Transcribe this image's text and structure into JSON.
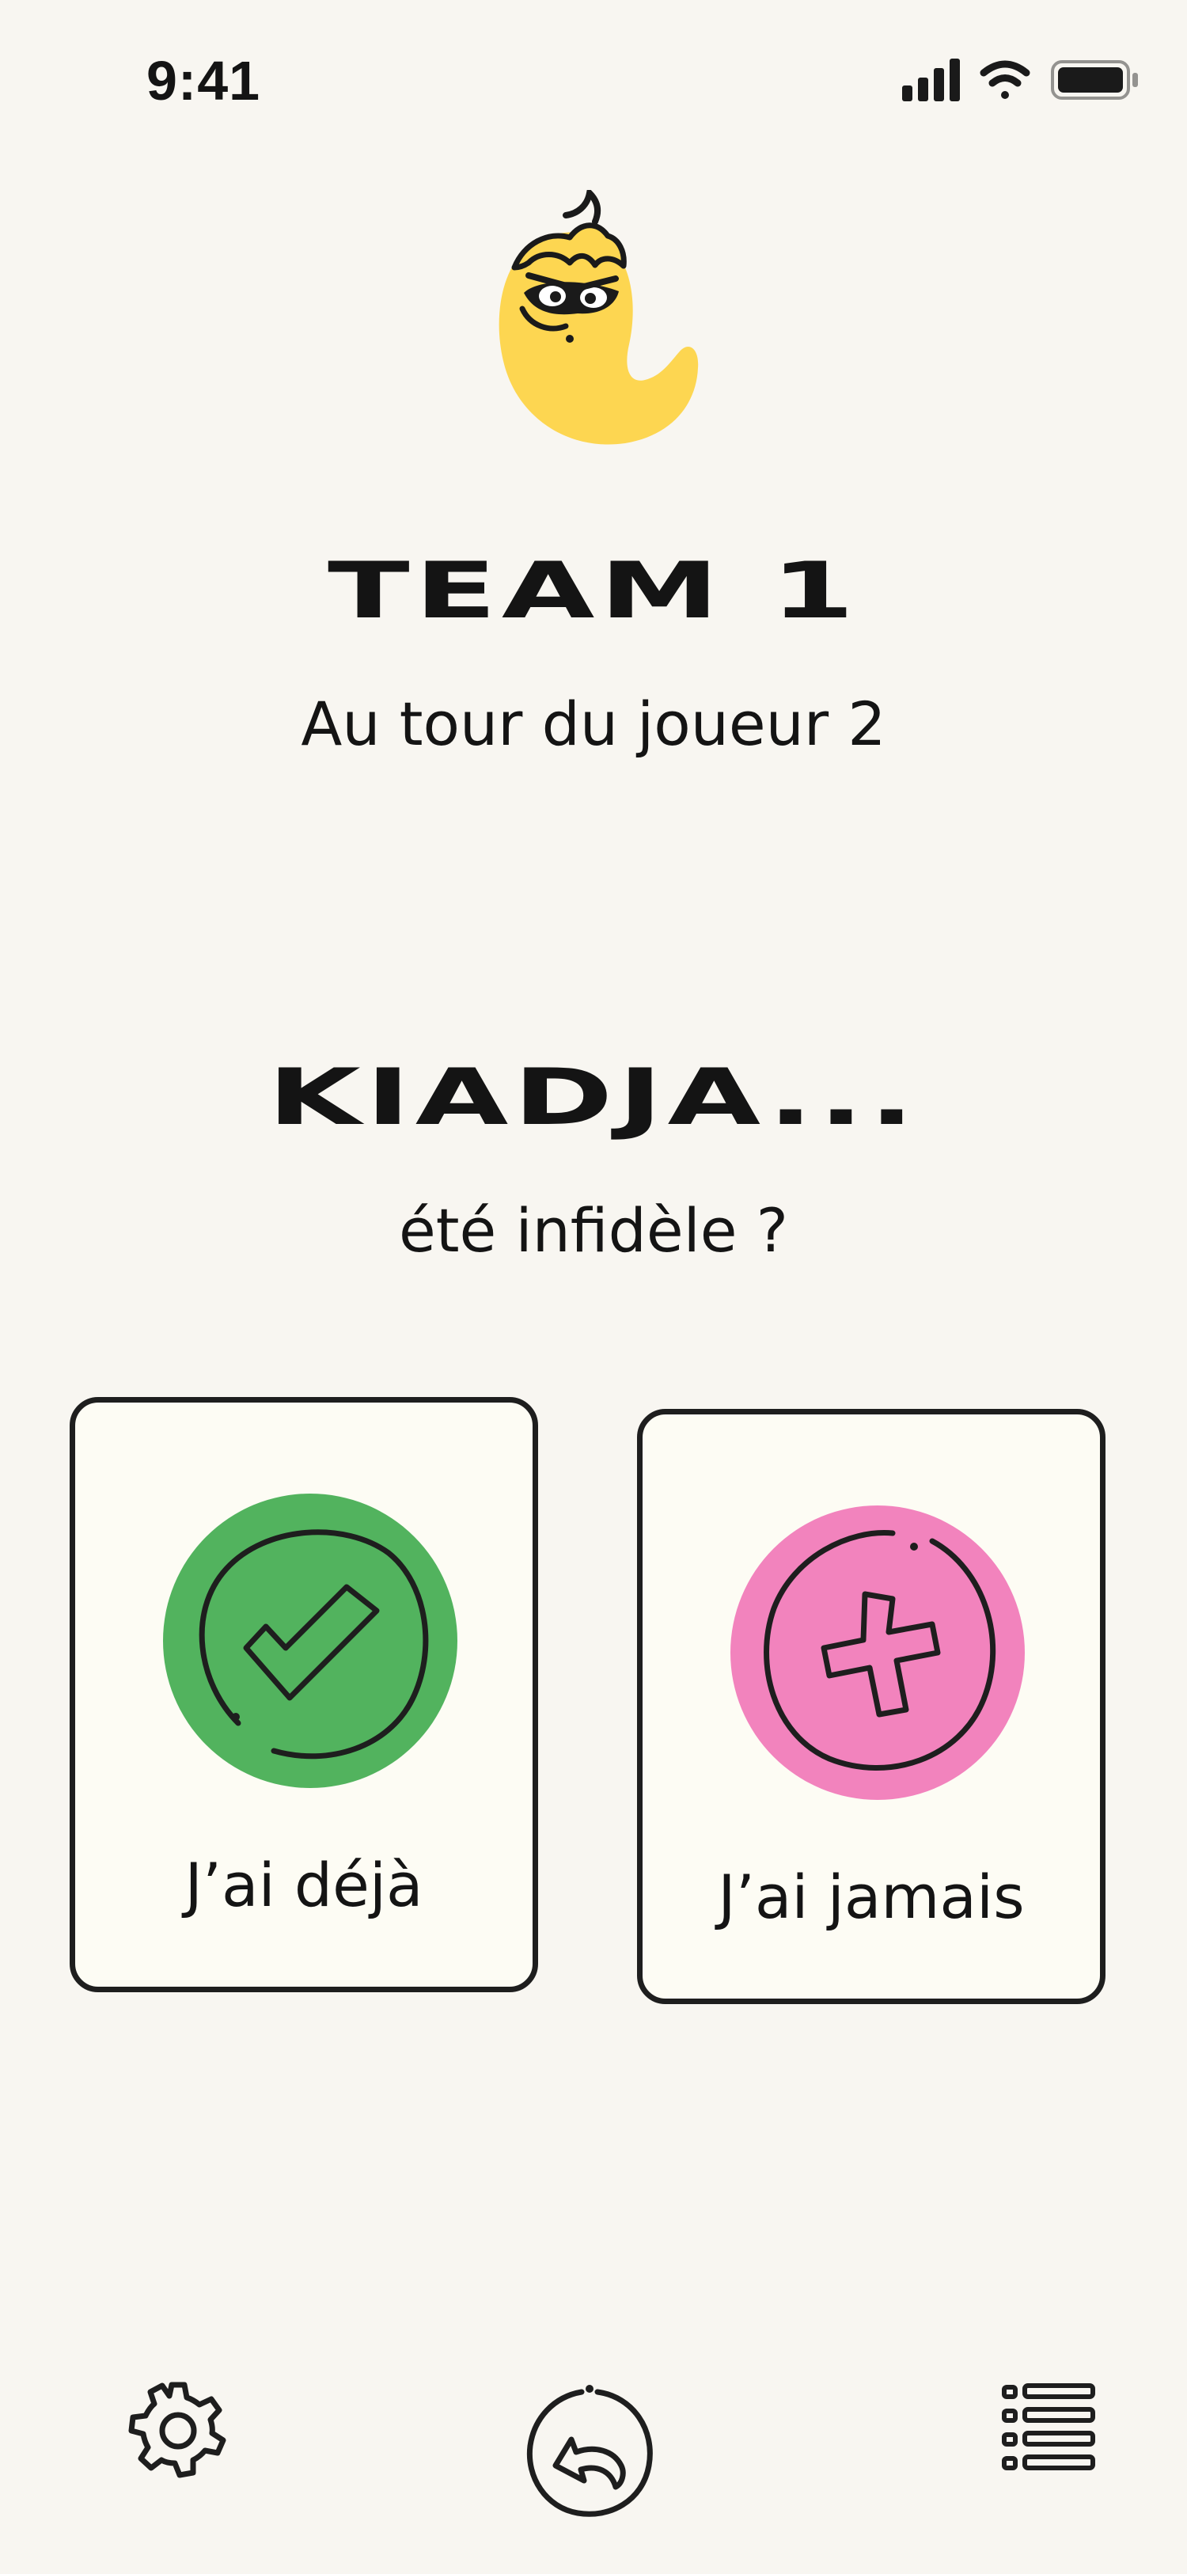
{
  "status_bar": {
    "time": "9:41",
    "icons": [
      "signal-icon",
      "wifi-icon",
      "battery-icon"
    ]
  },
  "game": {
    "mascot": "pepper-mascot-icon",
    "team_name": "TEAM 1",
    "turn_text": "Au tour du joueur 2",
    "player_name": "KIADJA...",
    "question": "été infidèle ?"
  },
  "answers": {
    "yes": {
      "label": "J’ai déjà",
      "color": "#52b35e",
      "icon": "check-icon"
    },
    "no": {
      "label": "J’ai jamais",
      "color": "#f283bd",
      "icon": "cross-icon"
    }
  },
  "bottom_nav": {
    "items": [
      "gear-icon",
      "undo-icon",
      "list-icon"
    ]
  },
  "colors": {
    "background": "#f8f6f1",
    "card": "#fdfcf4",
    "ink": "#141414",
    "mascot_yellow": "#fdd651"
  }
}
